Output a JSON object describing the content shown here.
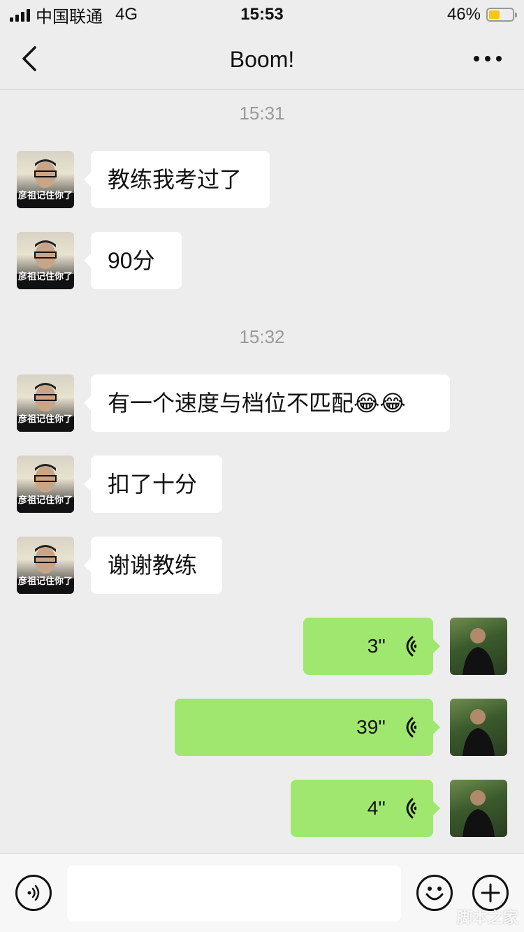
{
  "status_bar": {
    "carrier": "中国联通",
    "network": "4G",
    "time": "15:53",
    "battery_percent": "46%",
    "battery_level": 0.46
  },
  "header": {
    "title": "Boom!",
    "back_icon": "chevron-left-icon",
    "more_icon": "more-dots-icon"
  },
  "timestamps": [
    "15:31",
    "15:32"
  ],
  "messages": [
    {
      "direction": "in",
      "text": "教练我考过了"
    },
    {
      "direction": "in",
      "text": "90分"
    },
    {
      "direction": "in",
      "text": "有一个速度与档位不匹配😂😂"
    },
    {
      "direction": "in",
      "text": "扣了十分"
    },
    {
      "direction": "in",
      "text": "谢谢教练"
    },
    {
      "direction": "out",
      "type": "voice",
      "duration": "3''"
    },
    {
      "direction": "out",
      "type": "voice",
      "duration": "39''"
    },
    {
      "direction": "out",
      "type": "voice",
      "duration": "4''"
    }
  ],
  "avatar_caption": "彦祖记住你了",
  "input_bar": {
    "voice_icon": "voice-input-icon",
    "emoji_icon": "emoji-icon",
    "plus_icon": "plus-icon"
  },
  "watermark": "脚本之家",
  "colors": {
    "background": "#ededed",
    "bubble_in": "#ffffff",
    "bubble_out": "#a0e76f",
    "battery_fill": "#f5c518"
  }
}
